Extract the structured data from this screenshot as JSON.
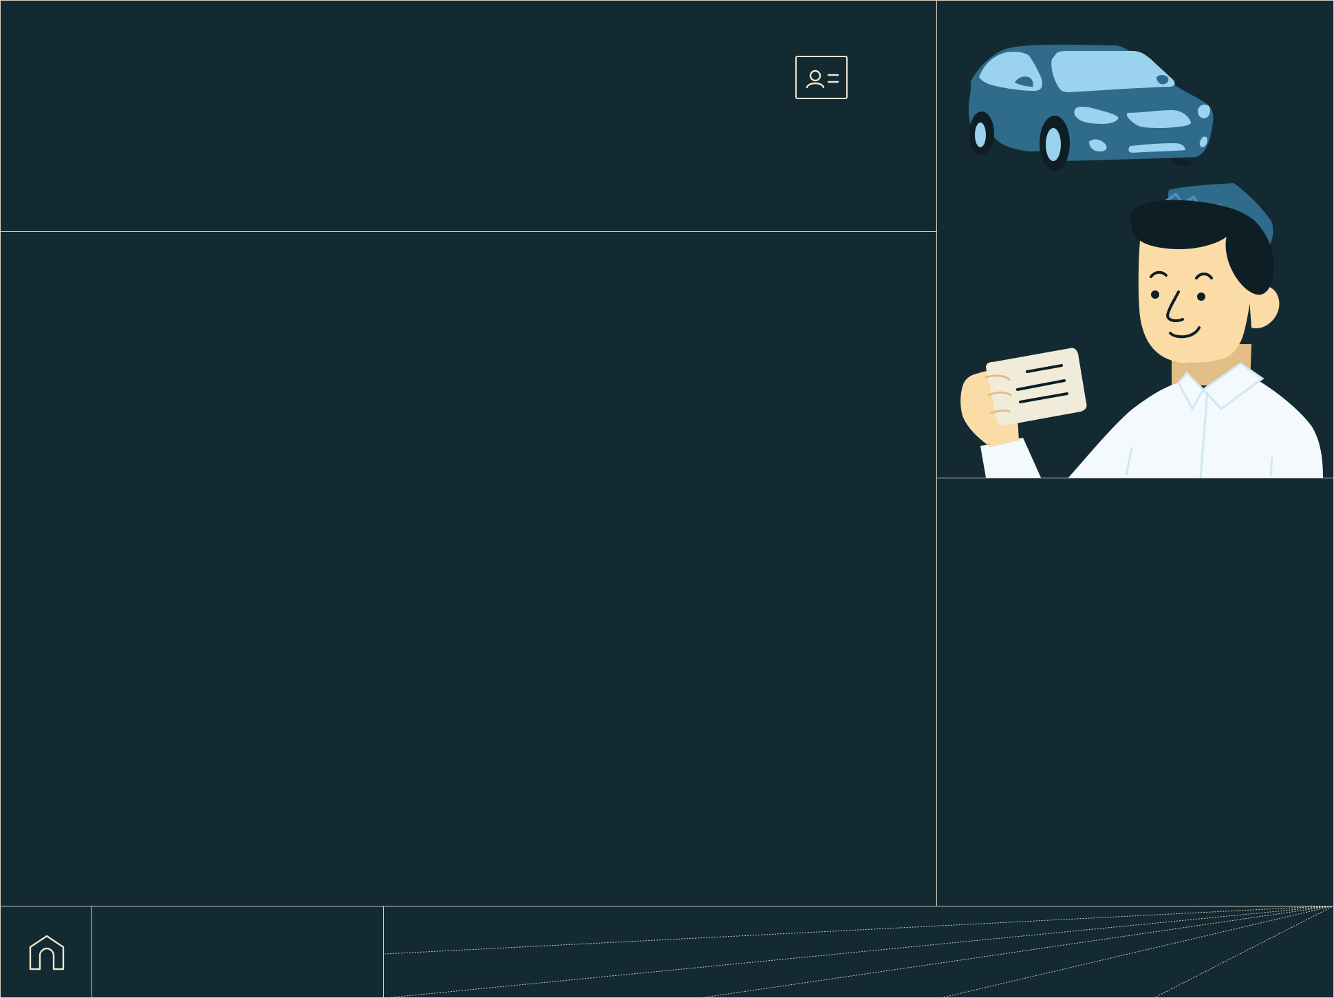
{
  "theme": {
    "background": "#132a32",
    "line": "#d8d1bb",
    "accent": "#f1e7cd",
    "car_body": "#2f6b8b",
    "car_glass": "#9bd3ef",
    "skin": "#fbdba6",
    "hair": "#0d1e24",
    "shirt": "#f3f9fc",
    "license_card": "#f1ecd9"
  },
  "header": {
    "actions": [
      {
        "id": "id-card",
        "icon": "id-card-icon"
      }
    ]
  },
  "illustration": {
    "subject": "person-holding-drivers-license-with-car",
    "icons": [
      "car-icon",
      "license-card-icon"
    ]
  },
  "footer": {
    "nav": [
      {
        "id": "home",
        "icon": "home-icon"
      }
    ]
  }
}
